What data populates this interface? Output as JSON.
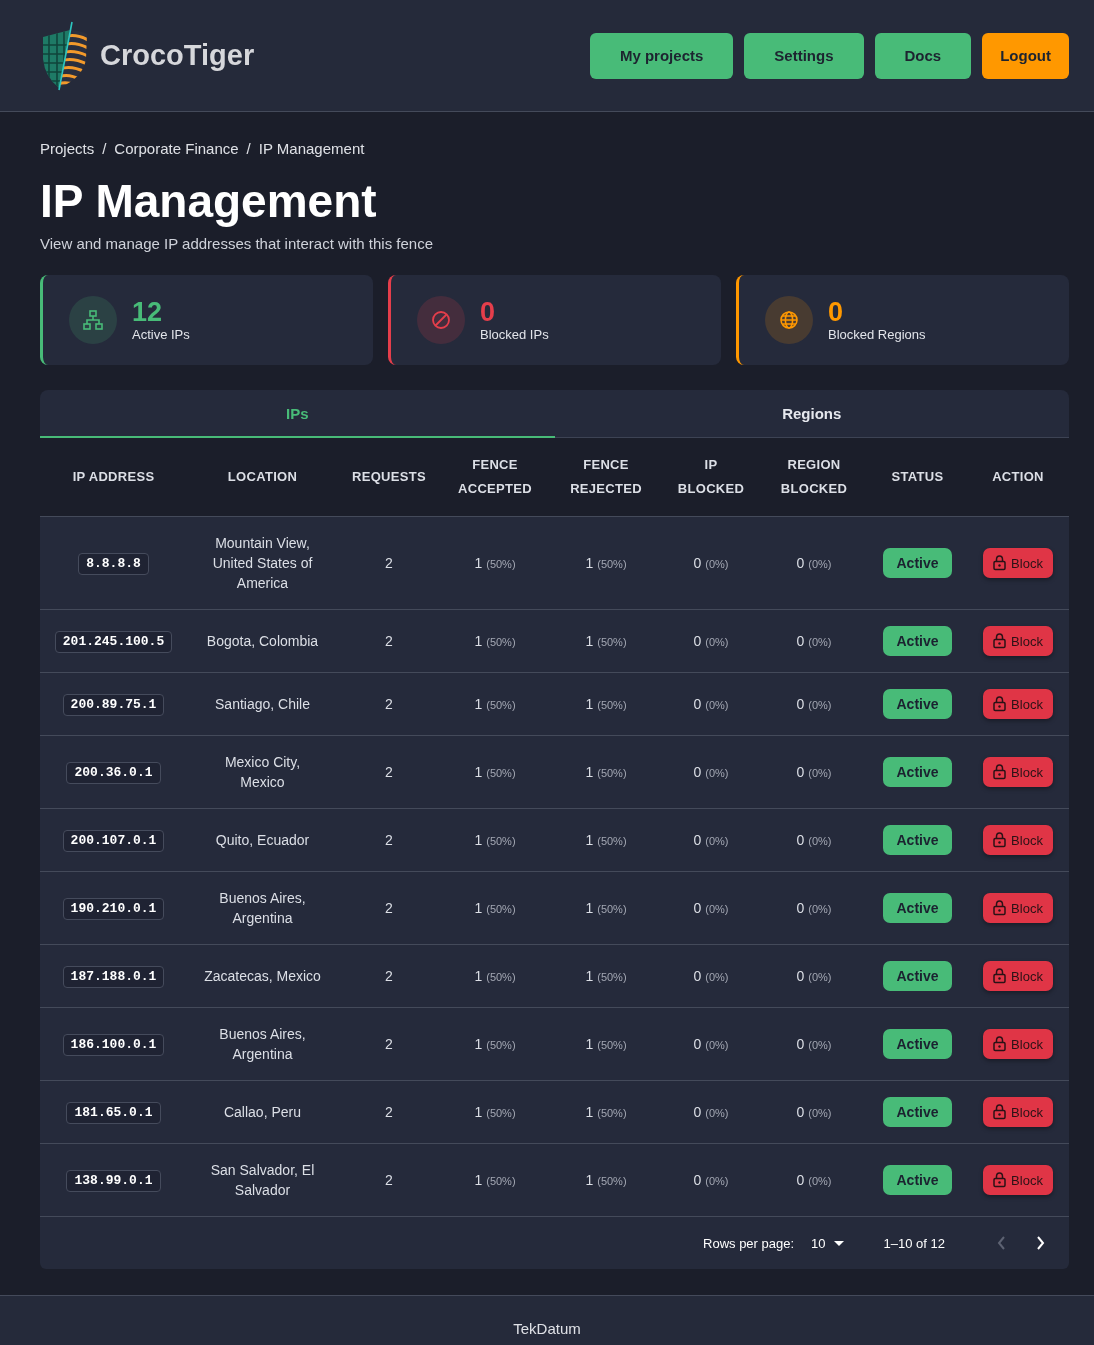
{
  "header": {
    "brand": "CrocoTiger",
    "nav": [
      {
        "label": "My projects",
        "kind": "primary"
      },
      {
        "label": "Settings",
        "kind": "primary"
      },
      {
        "label": "Docs",
        "kind": "primary"
      },
      {
        "label": "Logout",
        "kind": "warning"
      }
    ]
  },
  "breadcrumb": {
    "separator": "/",
    "items": [
      "Projects",
      "Corporate Finance",
      "IP Management"
    ]
  },
  "page": {
    "title": "IP Management",
    "subtitle": "View and manage IP addresses that interact with this fence"
  },
  "stats": [
    {
      "value": "12",
      "label": "Active IPs",
      "color": "#48bb78",
      "kind": "network"
    },
    {
      "value": "0",
      "label": "Blocked IPs",
      "color": "#e53e4b",
      "kind": "blocked"
    },
    {
      "value": "0",
      "label": "Blocked Regions",
      "color": "#ff9800",
      "kind": "globe"
    }
  ],
  "tabs": [
    {
      "label": "IPs",
      "selected": true
    },
    {
      "label": "Regions",
      "selected": false
    }
  ],
  "table": {
    "columns": [
      "IP ADDRESS",
      "LOCATION",
      "REQUESTS",
      "FENCE ACCEPTED",
      "FENCE REJECTED",
      "IP BLOCKED",
      "REGION BLOCKED",
      "STATUS",
      "ACTION"
    ],
    "rows": [
      {
        "ip": "8.8.8.8",
        "location": "Mountain View, United States of America",
        "requests": "2",
        "fence_accepted": {
          "count": "1",
          "percent": "(50%)"
        },
        "fence_rejected": {
          "count": "1",
          "percent": "(50%)"
        },
        "ip_blocked": {
          "count": "0",
          "percent": "(0%)"
        },
        "region_blocked": {
          "count": "0",
          "percent": "(0%)"
        },
        "status": {
          "label": "Active",
          "active": true
        },
        "action": "Block"
      },
      {
        "ip": "201.245.100.5",
        "location": "Bogota, Colombia",
        "requests": "2",
        "fence_accepted": {
          "count": "1",
          "percent": "(50%)"
        },
        "fence_rejected": {
          "count": "1",
          "percent": "(50%)"
        },
        "ip_blocked": {
          "count": "0",
          "percent": "(0%)"
        },
        "region_blocked": {
          "count": "0",
          "percent": "(0%)"
        },
        "status": {
          "label": "Active",
          "active": true
        },
        "action": "Block"
      },
      {
        "ip": "200.89.75.1",
        "location": "Santiago, Chile",
        "requests": "2",
        "fence_accepted": {
          "count": "1",
          "percent": "(50%)"
        },
        "fence_rejected": {
          "count": "1",
          "percent": "(50%)"
        },
        "ip_blocked": {
          "count": "0",
          "percent": "(0%)"
        },
        "region_blocked": {
          "count": "0",
          "percent": "(0%)"
        },
        "status": {
          "label": "Active",
          "active": true
        },
        "action": "Block"
      },
      {
        "ip": "200.36.0.1",
        "location": "Mexico City, Mexico",
        "requests": "2",
        "fence_accepted": {
          "count": "1",
          "percent": "(50%)"
        },
        "fence_rejected": {
          "count": "1",
          "percent": "(50%)"
        },
        "ip_blocked": {
          "count": "0",
          "percent": "(0%)"
        },
        "region_blocked": {
          "count": "0",
          "percent": "(0%)"
        },
        "status": {
          "label": "Active",
          "active": true
        },
        "action": "Block"
      },
      {
        "ip": "200.107.0.1",
        "location": "Quito, Ecuador",
        "requests": "2",
        "fence_accepted": {
          "count": "1",
          "percent": "(50%)"
        },
        "fence_rejected": {
          "count": "1",
          "percent": "(50%)"
        },
        "ip_blocked": {
          "count": "0",
          "percent": "(0%)"
        },
        "region_blocked": {
          "count": "0",
          "percent": "(0%)"
        },
        "status": {
          "label": "Active",
          "active": true
        },
        "action": "Block"
      },
      {
        "ip": "190.210.0.1",
        "location": "Buenos Aires, Argentina",
        "requests": "2",
        "fence_accepted": {
          "count": "1",
          "percent": "(50%)"
        },
        "fence_rejected": {
          "count": "1",
          "percent": "(50%)"
        },
        "ip_blocked": {
          "count": "0",
          "percent": "(0%)"
        },
        "region_blocked": {
          "count": "0",
          "percent": "(0%)"
        },
        "status": {
          "label": "Active",
          "active": true
        },
        "action": "Block"
      },
      {
        "ip": "187.188.0.1",
        "location": "Zacatecas, Mexico",
        "requests": "2",
        "fence_accepted": {
          "count": "1",
          "percent": "(50%)"
        },
        "fence_rejected": {
          "count": "1",
          "percent": "(50%)"
        },
        "ip_blocked": {
          "count": "0",
          "percent": "(0%)"
        },
        "region_blocked": {
          "count": "0",
          "percent": "(0%)"
        },
        "status": {
          "label": "Active",
          "active": true
        },
        "action": "Block"
      },
      {
        "ip": "186.100.0.1",
        "location": "Buenos Aires, Argentina",
        "requests": "2",
        "fence_accepted": {
          "count": "1",
          "percent": "(50%)"
        },
        "fence_rejected": {
          "count": "1",
          "percent": "(50%)"
        },
        "ip_blocked": {
          "count": "0",
          "percent": "(0%)"
        },
        "region_blocked": {
          "count": "0",
          "percent": "(0%)"
        },
        "status": {
          "label": "Active",
          "active": true
        },
        "action": "Block"
      },
      {
        "ip": "181.65.0.1",
        "location": "Callao, Peru",
        "requests": "2",
        "fence_accepted": {
          "count": "1",
          "percent": "(50%)"
        },
        "fence_rejected": {
          "count": "1",
          "percent": "(50%)"
        },
        "ip_blocked": {
          "count": "0",
          "percent": "(0%)"
        },
        "region_blocked": {
          "count": "0",
          "percent": "(0%)"
        },
        "status": {
          "label": "Active",
          "active": true
        },
        "action": "Block"
      },
      {
        "ip": "138.99.0.1",
        "location": "San Salvador, El Salvador",
        "requests": "2",
        "fence_accepted": {
          "count": "1",
          "percent": "(50%)"
        },
        "fence_rejected": {
          "count": "1",
          "percent": "(50%)"
        },
        "ip_blocked": {
          "count": "0",
          "percent": "(0%)"
        },
        "region_blocked": {
          "count": "0",
          "percent": "(0%)"
        },
        "status": {
          "label": "Active",
          "active": true
        },
        "action": "Block"
      }
    ]
  },
  "pagination": {
    "rows_per_page_label": "Rows per page:",
    "rows_per_page": "10",
    "range": "1–10 of 12",
    "previous_disabled": true,
    "next_disabled": false
  },
  "footer": {
    "text": "TekDatum"
  }
}
